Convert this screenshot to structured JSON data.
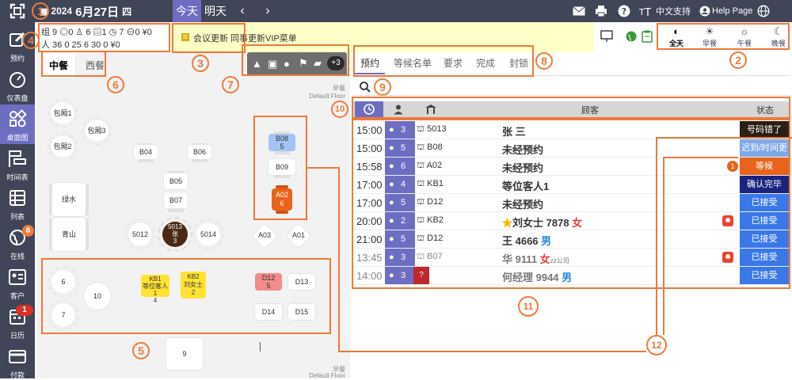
{
  "topbar": {
    "year": "2024",
    "month_day": "6月27日",
    "weekday": "四",
    "today": "今天",
    "tomorrow": "明天",
    "prev": "‹",
    "next": "›",
    "lang": "中文支持",
    "help": "Help Page"
  },
  "sidebar": {
    "items": [
      {
        "label": "预约",
        "icon": "edit-icon"
      },
      {
        "label": "仪表盘",
        "icon": "dashboard-icon"
      },
      {
        "label": "桌面图",
        "icon": "floorplan-icon"
      },
      {
        "label": "时间表",
        "icon": "timeline-icon"
      },
      {
        "label": "列表",
        "icon": "list-icon"
      },
      {
        "label": "在线",
        "icon": "globe-icon",
        "badge": "8"
      },
      {
        "label": "客户",
        "icon": "customer-icon"
      },
      {
        "label": "日历",
        "icon": "calendar-icon",
        "badge": "1"
      },
      {
        "label": "付款",
        "icon": "card-icon"
      }
    ]
  },
  "stats": {
    "row1": "组  9 ◎0 ♙ 6 ▤1 ◷  7 ⊖0 ¥0",
    "row2": "人 36    0   25    6   30    0 ¥0"
  },
  "notice": "会议更新 同事更新VIP菜单",
  "meals": [
    {
      "label": "全天",
      "icon": "half-moon-icon",
      "active": true
    },
    {
      "label": "早餐",
      "icon": "sunrise-icon"
    },
    {
      "label": "午餐",
      "icon": "sun-icon"
    },
    {
      "label": "晚餐",
      "icon": "moon-icon"
    }
  ],
  "floor": {
    "tabs": [
      "中餐",
      "西餐"
    ],
    "filter_count": "+3",
    "label_meal": "早餐",
    "label_floor": "Default Floor",
    "rooms": [
      "包厢1",
      "包厢3",
      "包厢2"
    ],
    "tables": {
      "b04": "B04",
      "b06": "B06",
      "b05": "B05",
      "b07": "B07",
      "t5012": "5012",
      "t5013": "5013",
      "t5013_sub": "张",
      "t5013_n": "3",
      "t5014": "5014",
      "b08": "B08",
      "b08_n": "5",
      "b09": "B09",
      "a02": "A02",
      "a02_n": "6",
      "a03": "A03",
      "a01": "A01",
      "lvshui": "绿水",
      "qingshan": "青山",
      "t6": "6",
      "t10": "10",
      "t7": "7",
      "kb1": "KB1",
      "kb1_sub": "等位客人1",
      "kb1_n": "4",
      "kb2": "KB2",
      "kb2_sub": "刘女士",
      "kb2_n": "2",
      "d12": "D12",
      "d12_n": "5",
      "d13": "D13",
      "d14": "D14",
      "d15": "D15",
      "t9": "9"
    }
  },
  "right": {
    "tabs": [
      "预约",
      "等候名单",
      "要求",
      "完成",
      "封锁"
    ],
    "header_guest": "顾客",
    "header_status": "状态",
    "rows": [
      {
        "time": "15:00",
        "party": "3",
        "table": "5013",
        "guest": "张 三",
        "status": "号码错了",
        "status_color": "#2a1f14"
      },
      {
        "time": "15:00",
        "party": "5",
        "table": "B08",
        "guest": "未经预约",
        "status": "迟到/时间更",
        "status_color": "#7fa8e8"
      },
      {
        "time": "15:58",
        "party": "6",
        "table": "A02",
        "guest": "未经预约",
        "status": "等候",
        "status_color": "#e8631c"
      },
      {
        "time": "17:00",
        "party": "4",
        "table": "KB1",
        "guest": "等位客人1",
        "status": "确认完毕",
        "status_color": "#1a237e"
      },
      {
        "time": "17:00",
        "party": "5",
        "table": "D12",
        "guest": "未经预约",
        "status": "已接受",
        "status_color": "#3a78e8"
      },
      {
        "time": "20:00",
        "party": "2",
        "table": "KB2",
        "guest": "刘女士 7878",
        "gender": "女",
        "status": "已接受",
        "status_color": "#3a78e8"
      },
      {
        "time": "21:00",
        "party": "5",
        "table": "D12",
        "guest": "王 4666",
        "gender": "男",
        "status": "已接受",
        "status_color": "#3a78e8"
      },
      {
        "time": "13:45",
        "party": "3",
        "table": "B07",
        "guest": "华 9111",
        "gender": "女",
        "company": "zz公司",
        "status": "已接受",
        "status_color": "#3a78e8"
      },
      {
        "time": "14:00",
        "party": "3",
        "table": "?",
        "guest": "何经理 9944",
        "gender": "男",
        "status": "已接受",
        "status_color": "#3a78e8"
      }
    ]
  },
  "callouts": [
    "1",
    "2",
    "3",
    "4",
    "5",
    "6",
    "7",
    "8",
    "9",
    "10",
    "11",
    "12"
  ],
  "colors": {
    "sidebar": "#414558",
    "accent": "#6d6ec2",
    "callout": "#ee7a3a",
    "notice_bg": "#ffffc8",
    "table_kb": "#ffe234",
    "table_b08": "#a3c4f3",
    "table_a02": "#e8631c",
    "table_d12": "#f28b8b",
    "table_5013": "#4a2a14"
  }
}
